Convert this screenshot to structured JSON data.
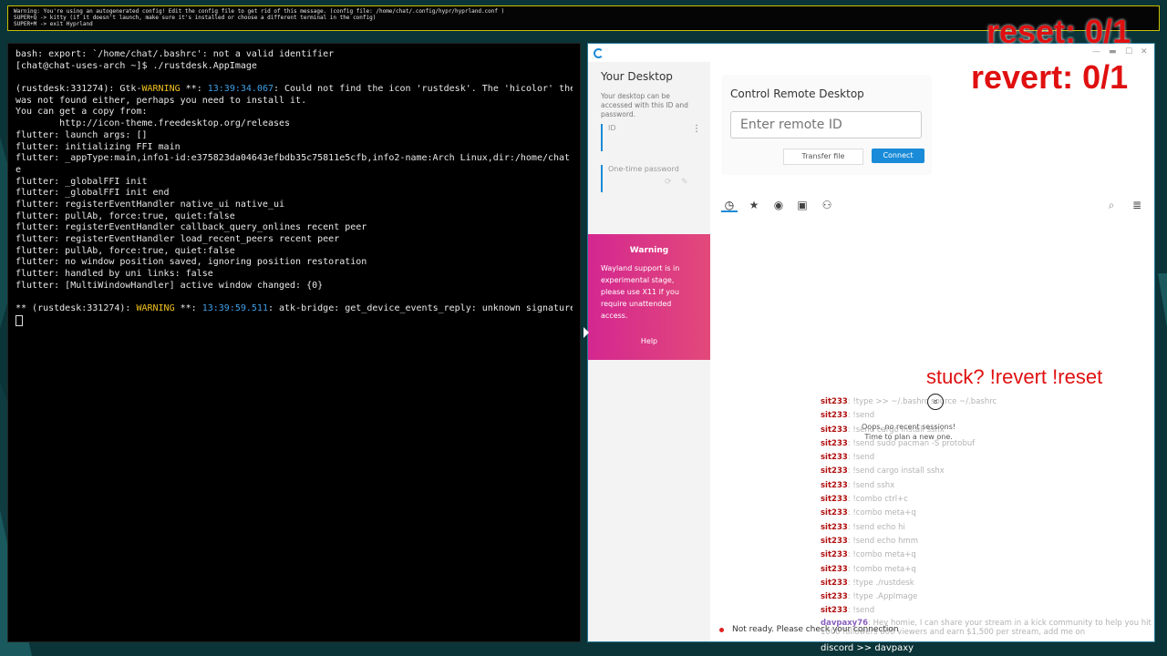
{
  "topbar": {
    "lines": [
      "Warning: You're using an autogenerated config! Edit the config file to get rid of this message. (config file: /home/chat/.config/hypr/hyprland.conf )",
      "SUPER+Q -> kitty (if it doesn't launch, make sure it's installed or choose a different terminal in the config)",
      "SUPER+M -> exit Hyprland"
    ]
  },
  "terminal": {
    "lines": [
      "bash: export: `/home/chat/.bashrc': not a valid identifier",
      "[chat@chat-uses-arch ~]$ ./rustdesk.AppImage",
      "",
      "(rustdesk:331274): Gtk-",
      "was not found either, perhaps you need to install it.",
      "You can get a copy from:",
      "        http://icon-theme.freedesktop.org/releases",
      "flutter: launch args: []",
      "flutter: initializing FFI main",
      "flutter: _appType:main,info1-id:e375823da04643efbdb35c75811e5cfb,info2-name:Arch Linux,dir:/home/chat",
      "e",
      "flutter: _globalFFI init",
      "flutter: _globalFFI init end",
      "flutter: registerEventHandler native_ui native_ui",
      "flutter: pullAb, force:true, quiet:false",
      "flutter: registerEventHandler callback_query_onlines recent peer",
      "flutter: registerEventHandler load_recent_peers recent peer",
      "flutter: pullAb, force:true, quiet:false",
      "flutter: no window position saved, ignoring position restoration",
      "flutter: handled by uni links: false",
      "flutter: [MultiWindowHandler] active window changed: {0}",
      "",
      "** (rustdesk:331274): "
    ],
    "gtk_warning": {
      "prefix": "(rustdesk:331274): Gtk-",
      "warn": "WARNING",
      "mid": " **: ",
      "time": "13:39:34.067",
      "suffix": ": Could not find the icon 'rustdesk'. The 'hicolor' them"
    },
    "atk_warning": {
      "prefix": "** (rustdesk:331274): ",
      "warn": "WARNING",
      "mid": " **: ",
      "time": "13:39:59.511",
      "suffix": ": atk-bridge: get_device_events_reply: unknown signature"
    }
  },
  "rustdesk": {
    "your_desktop_title": "Your Desktop",
    "your_desktop_sub": "Your desktop can be accessed with this ID and password.",
    "id_label": "ID",
    "otp_label": "One-time password",
    "warning_title": "Warning",
    "warning_text": "Wayland support is in experimental stage, please use X11 if you require unattended access.",
    "help_label": "Help",
    "control_title": "Control Remote Desktop",
    "remote_placeholder": "Enter remote ID",
    "transfer_label": "Transfer file",
    "connect_label": "Connect",
    "empty_text": "Oops, no recent sessions!\nTime to plan a new one.",
    "status_text": "Not ready. Please check your connection",
    "tab_icons": [
      "clock-icon",
      "star-icon",
      "compass-icon",
      "address-book-icon",
      "group-icon"
    ],
    "right_icons": [
      "search-icon",
      "list-view-icon"
    ]
  },
  "overlay": {
    "reset": "reset: 0/1",
    "revert": "revert: 0/1",
    "stuck": "stuck? !revert !reset"
  },
  "chat": {
    "messages": [
      {
        "user": "sit233",
        "text": ": !type >> ~/.bashrc source ~/.bashrc"
      },
      {
        "user": "sit233",
        "text": ": !send"
      },
      {
        "user": "sit233",
        "text": ": !send cargo install sshx"
      },
      {
        "user": "sit233",
        "text": ": !send sudo pacman -S protobuf"
      },
      {
        "user": "sit233",
        "text": ": !send"
      },
      {
        "user": "sit233",
        "text": ": !send cargo install sshx"
      },
      {
        "user": "sit233",
        "text": ": !send sshx"
      },
      {
        "user": "sit233",
        "text": ": !combo ctrl+c"
      },
      {
        "user": "sit233",
        "text": ": !combo meta+q"
      },
      {
        "user": "sit233",
        "text": ": !send echo hi"
      },
      {
        "user": "sit233",
        "text": ": !send echo hmm"
      },
      {
        "user": "sit233",
        "text": ": !combo meta+q"
      },
      {
        "user": "sit233",
        "text": ": !combo meta+q"
      },
      {
        "user": "sit233",
        "text": ": !type ./rustdesk"
      },
      {
        "user": "sit233",
        "text": ": !type .AppImage"
      },
      {
        "user": "sit233",
        "text": ": !send"
      }
    ],
    "last_user": "davpaxy76",
    "last_text": ": Hey homie, I can share your stream in a kick community to help you hit 1000 followers 800 viewers and earn $1,500 per stream, add me on",
    "discord": "discord >> davpaxy"
  },
  "colors": {
    "accent": "#1a8bd8",
    "warning_gradient_start": "#d42790",
    "warning_gradient_end": "#e2497a",
    "overlay_red": "#e01010",
    "terminal_warn": "#f0c020",
    "terminal_time": "#3fa0e8"
  }
}
